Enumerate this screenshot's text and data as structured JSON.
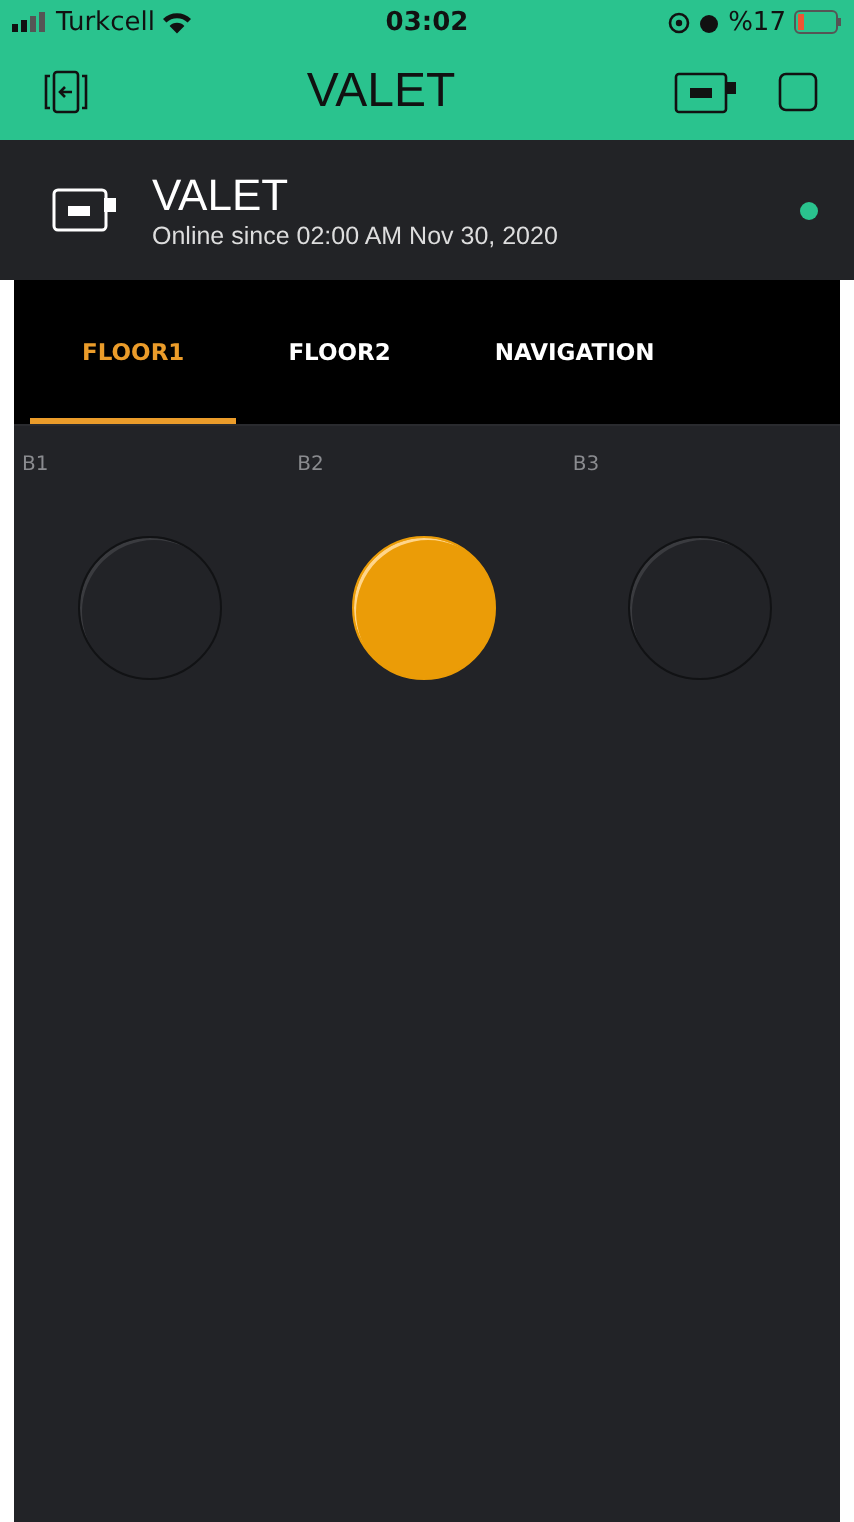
{
  "status_bar": {
    "carrier": "Turkcell",
    "time": "03:02",
    "battery": "%17"
  },
  "header": {
    "title": "VALET"
  },
  "device": {
    "name": "VALET",
    "status": "Online since 02:00 AM Nov 30, 2020",
    "online": true
  },
  "tabs": [
    {
      "label": "FLOOR1",
      "selected": true
    },
    {
      "label": "FLOOR2",
      "selected": false
    },
    {
      "label": "NAVIGATION",
      "selected": false
    }
  ],
  "buttons": [
    {
      "label": "B1",
      "on": false
    },
    {
      "label": "B2",
      "on": true
    },
    {
      "label": "B3",
      "on": false
    }
  ]
}
